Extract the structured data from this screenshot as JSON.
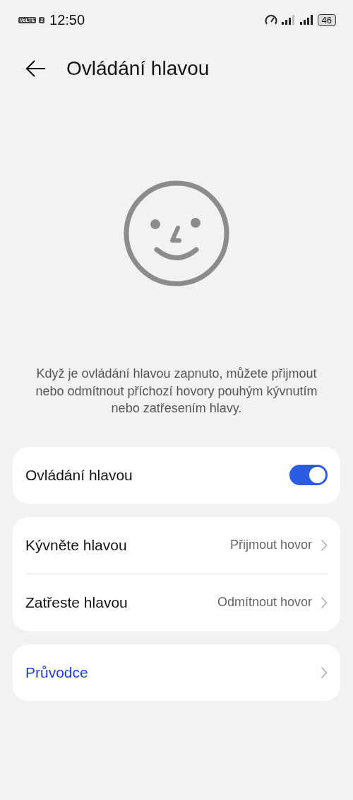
{
  "status_bar": {
    "network_badge": "VoLTE",
    "sim_badge": "2",
    "time": "12:50",
    "battery": "46"
  },
  "header": {
    "title": "Ovládání hlavou"
  },
  "description": "Když je ovládání hlavou zapnuto, můžete přijmout nebo odmítnout příchozí hovory pouhým kývnutím nebo zatřesením hlavy.",
  "groups": [
    {
      "rows": [
        {
          "kind": "switch",
          "label": "Ovládání hlavou",
          "on": true
        }
      ]
    },
    {
      "rows": [
        {
          "kind": "link",
          "label": "Kývněte hlavou",
          "value": "Přijmout hovor"
        },
        {
          "kind": "link",
          "label": "Zatřeste hlavou",
          "value": "Odmítnout hovor"
        }
      ]
    },
    {
      "rows": [
        {
          "kind": "accent-link",
          "label": "Průvodce"
        }
      ]
    }
  ]
}
